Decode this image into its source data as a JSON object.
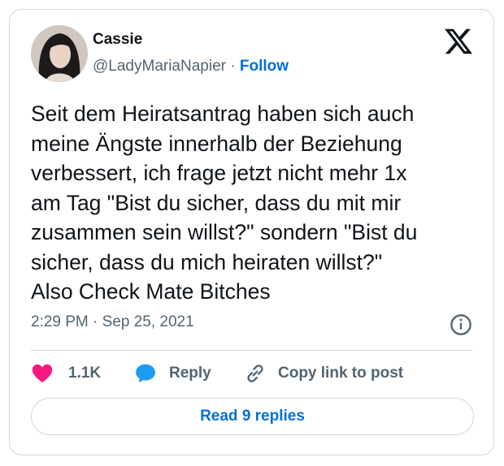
{
  "tweet": {
    "author": {
      "display_name": "Cassie",
      "handle": "@LadyMariaNapier",
      "separator": "·",
      "follow_label": "Follow"
    },
    "text": "Seit dem Heiratsantrag haben sich auch\nmeine Ängste innerhalb der Beziehung\nverbessert, ich frage jetzt nicht mehr 1x\nam Tag \"Bist du sicher, dass du mit mir\nzusammen sein willst?\" sondern \"Bist du\nsicher, dass du mich heiraten willst?\"\nAlso Check Mate Bitches",
    "timestamp": "2:29 PM · Sep 25, 2021",
    "actions": {
      "likes_count": "1.1K",
      "reply_label": "Reply",
      "copy_link_label": "Copy link to post"
    },
    "read_replies_label": "Read 9 replies"
  },
  "icons": {
    "brand": "x-logo-icon",
    "like": "heart-icon",
    "reply": "speech-bubble-icon",
    "copy": "link-icon",
    "info": "info-icon"
  },
  "colors": {
    "like": "#f91880",
    "reply_bubble": "#1d9bf0",
    "accent": "#006fd6",
    "muted": "#536471",
    "border": "#cfd9de"
  }
}
